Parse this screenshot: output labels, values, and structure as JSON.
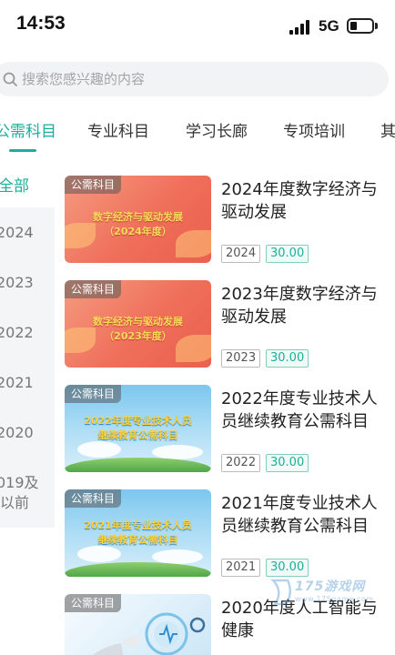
{
  "status_bar": {
    "time": "14:53",
    "network": "5G",
    "battery_level": 0.3
  },
  "search": {
    "placeholder": "搜索您感兴趣的内容"
  },
  "tabs": [
    {
      "label": "公需科目",
      "active": true
    },
    {
      "label": "专业科目",
      "active": false
    },
    {
      "label": "学习长廊",
      "active": false
    },
    {
      "label": "专项培训",
      "active": false
    },
    {
      "label": "其",
      "active": false
    }
  ],
  "years": [
    {
      "label": "全部",
      "active": true
    },
    {
      "label": "2024",
      "active": false
    },
    {
      "label": "2023",
      "active": false
    },
    {
      "label": "2022",
      "active": false
    },
    {
      "label": "2021",
      "active": false
    },
    {
      "label": "2020",
      "active": false
    },
    {
      "label_line1": "019及",
      "label_line2": "以前",
      "active": false
    }
  ],
  "courses": [
    {
      "tag": "公需科目",
      "thumb_title_line1": "数字经济与驱动发展",
      "thumb_title_line2": "（2024年度）",
      "title": "2024年度数字经济与驱动发展",
      "year": "2024",
      "credit": "30.00"
    },
    {
      "tag": "公需科目",
      "thumb_title_line1": "数字经济与驱动发展",
      "thumb_title_line2": "（2023年度）",
      "title": "2023年度数字经济与驱动发展",
      "year": "2023",
      "credit": "30.00"
    },
    {
      "tag": "公需科目",
      "thumb_title_line1": "2022年度专业技术人员",
      "thumb_title_line2": "继续教育公需科目",
      "title": "2022年度专业技术人员继续教育公需科目",
      "year": "2022",
      "credit": "30.00"
    },
    {
      "tag": "公需科目",
      "thumb_title_line1": "2021年度专业技术人员",
      "thumb_title_line2": "继续教育公需科目",
      "title": "2021年度专业技术人员继续教育公需科目",
      "year": "2021",
      "credit": "30.00"
    },
    {
      "tag": "公需科目",
      "title": "2020年度人工智能与健康"
    }
  ],
  "watermark": {
    "text": "175游戏网",
    "url": "www.175game.com"
  },
  "colors": {
    "accent": "#1cae9a",
    "text": "#222222",
    "muted": "#777777",
    "sidebar_bg": "#f4f5f7"
  }
}
